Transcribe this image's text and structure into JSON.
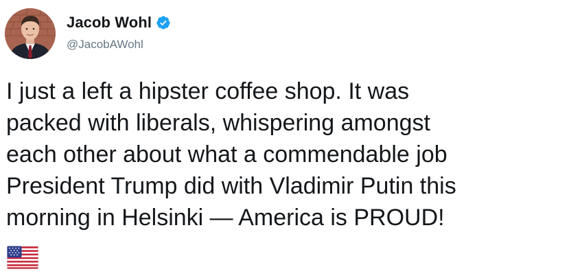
{
  "author": {
    "display_name": "Jacob Wohl",
    "handle": "@JacobAWohl",
    "verified": true,
    "verified_color": "#1da1f2"
  },
  "tweet": {
    "lines": [
      "I just a left a hipster coffee shop. It was",
      "packed with liberals, whispering amongst",
      "each other about what a commendable job",
      "President Trump did with Vladimir Putin this",
      "morning in Helsinki — America is PROUD!"
    ],
    "emoji": "us-flag-emoji"
  },
  "colors": {
    "text": "#14171a",
    "handle": "#657786",
    "background": "#ffffff"
  }
}
